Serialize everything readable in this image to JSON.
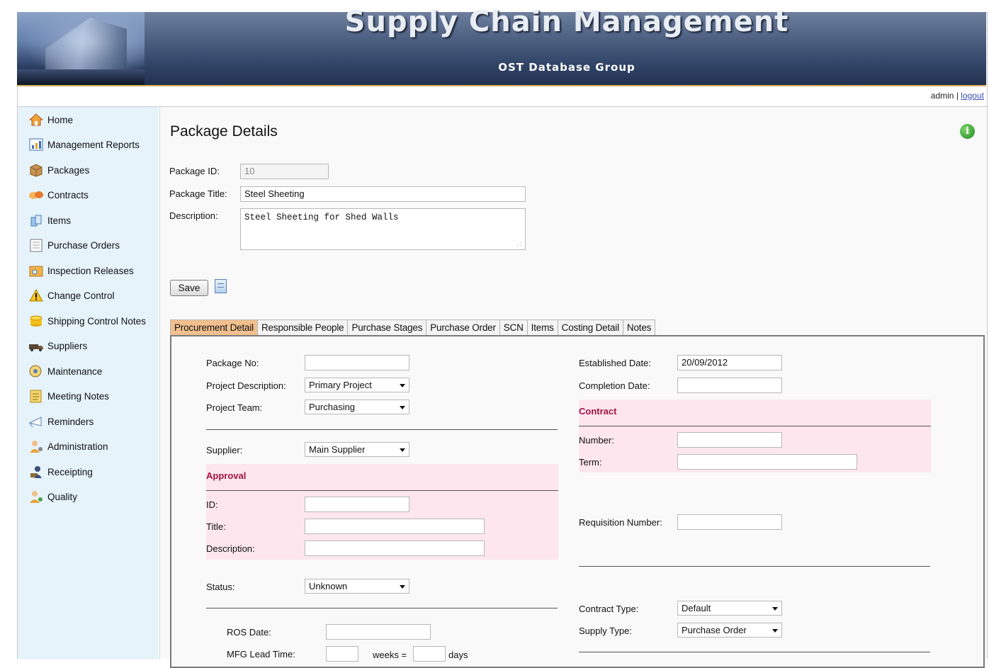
{
  "header": {
    "title": "Supply Chain Management",
    "subtitle": "OST Database Group"
  },
  "userbar": {
    "user": "admin",
    "separator": "|",
    "logout": "logout"
  },
  "sidebar": {
    "items": [
      {
        "label": "Home",
        "icon": "home-icon"
      },
      {
        "label": "Management Reports",
        "icon": "chart-report-icon"
      },
      {
        "label": "Packages",
        "icon": "package-box-icon"
      },
      {
        "label": "Contracts",
        "icon": "handshake-icon"
      },
      {
        "label": "Items",
        "icon": "items-icon"
      },
      {
        "label": "Purchase Orders",
        "icon": "clipboard-icon"
      },
      {
        "label": "Inspection Releases",
        "icon": "inspection-folder-icon"
      },
      {
        "label": "Change Control",
        "icon": "warning-icon"
      },
      {
        "label": "Shipping Control Notes",
        "icon": "stacked-coins-icon"
      },
      {
        "label": "Suppliers",
        "icon": "truck-icon"
      },
      {
        "label": "Maintenance",
        "icon": "maintenance-icon"
      },
      {
        "label": "Meeting Notes",
        "icon": "notes-icon"
      },
      {
        "label": "Reminders",
        "icon": "reminder-icon"
      },
      {
        "label": "Administration",
        "icon": "admin-user-icon"
      },
      {
        "label": "Receipting",
        "icon": "receipting-icon"
      },
      {
        "label": "Quality",
        "icon": "quality-user-icon"
      }
    ]
  },
  "page": {
    "title": "Package Details",
    "package_id_label": "Package ID:",
    "package_id_value": "10",
    "package_title_label": "Package Title:",
    "package_title_value": "Steel Sheeting",
    "description_label": "Description:",
    "description_value": "Steel Sheeting for Shed Walls",
    "save_label": "Save"
  },
  "tabs": [
    "Procurement Detail",
    "Responsible People",
    "Purchase Stages",
    "Purchase Order",
    "SCN",
    "Items",
    "Costing Detail",
    "Notes"
  ],
  "active_tab": "Procurement Detail",
  "form": {
    "package_no": {
      "label": "Package No:",
      "value": ""
    },
    "project_description": {
      "label": "Project Description:",
      "value": "Primary Project"
    },
    "project_team": {
      "label": "Project Team:",
      "value": "Purchasing"
    },
    "supplier": {
      "label": "Supplier:",
      "value": "Main Supplier"
    },
    "approval": {
      "heading": "Approval",
      "id_label": "ID:",
      "id_value": "",
      "title_label": "Title:",
      "title_value": "",
      "description_label": "Description:",
      "description_value": ""
    },
    "status": {
      "label": "Status:",
      "value": "Unknown"
    },
    "ros_date": {
      "label": "ROS Date:",
      "value": ""
    },
    "mfg_lead_time": {
      "label": "MFG Lead Time:",
      "weeks_value": "",
      "weeks_label": "weeks =",
      "days_value": "",
      "days_label": "days"
    },
    "established_date": {
      "label": "Established Date:",
      "value": "20/09/2012"
    },
    "completion_date": {
      "label": "Completion Date:",
      "value": ""
    },
    "contract": {
      "heading": "Contract",
      "number_label": "Number:",
      "number_value": "",
      "term_label": "Term:",
      "term_value": ""
    },
    "requisition_number": {
      "label": "Requisition Number:",
      "value": ""
    },
    "contract_type": {
      "label": "Contract Type:",
      "value": "Default"
    },
    "supply_type": {
      "label": "Supply Type:",
      "value": "Purchase Order"
    }
  }
}
